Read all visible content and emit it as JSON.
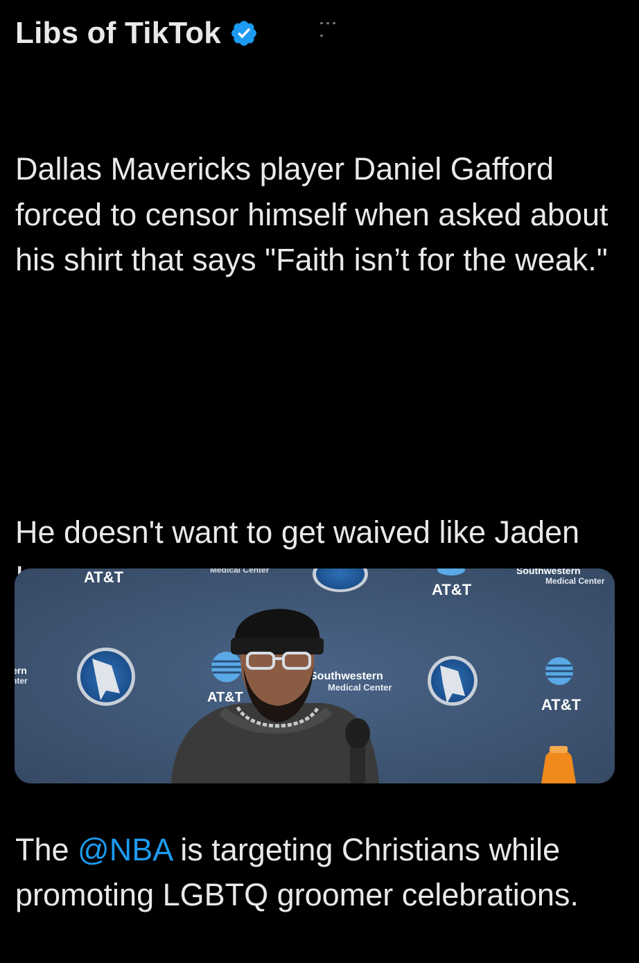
{
  "tweet": {
    "author_name": "Libs of TikTok",
    "paragraphs": {
      "p1": "Dallas Mavericks player Daniel Gafford forced to censor himself when asked about his shirt that says \"Faith isn’t for the weak.\"",
      "p2": "He doesn't want to get waived like Jaden Ivey.",
      "p3_before": "The ",
      "p3_mention": "@NBA",
      "p3_after": " is targeting Christians while promoting LGBTQ groomer celebrations."
    }
  },
  "media": {
    "backdrop": {
      "att": "AT&T",
      "southwestern": "Southwestern",
      "medical_center": "Medical Center",
      "medical_center_top": "Medical Center",
      "southwestern_top": "Southwestern",
      "edge_partial_1": "ern",
      "edge_partial_2": "nter"
    }
  },
  "colors": {
    "background": "#000000",
    "text": "#e7e9ea",
    "mention": "#1d9bf0",
    "verified": "#1d9bf0",
    "backdrop": "#3b4f6b"
  },
  "icons": {
    "verified": "verified-badge-icon"
  }
}
